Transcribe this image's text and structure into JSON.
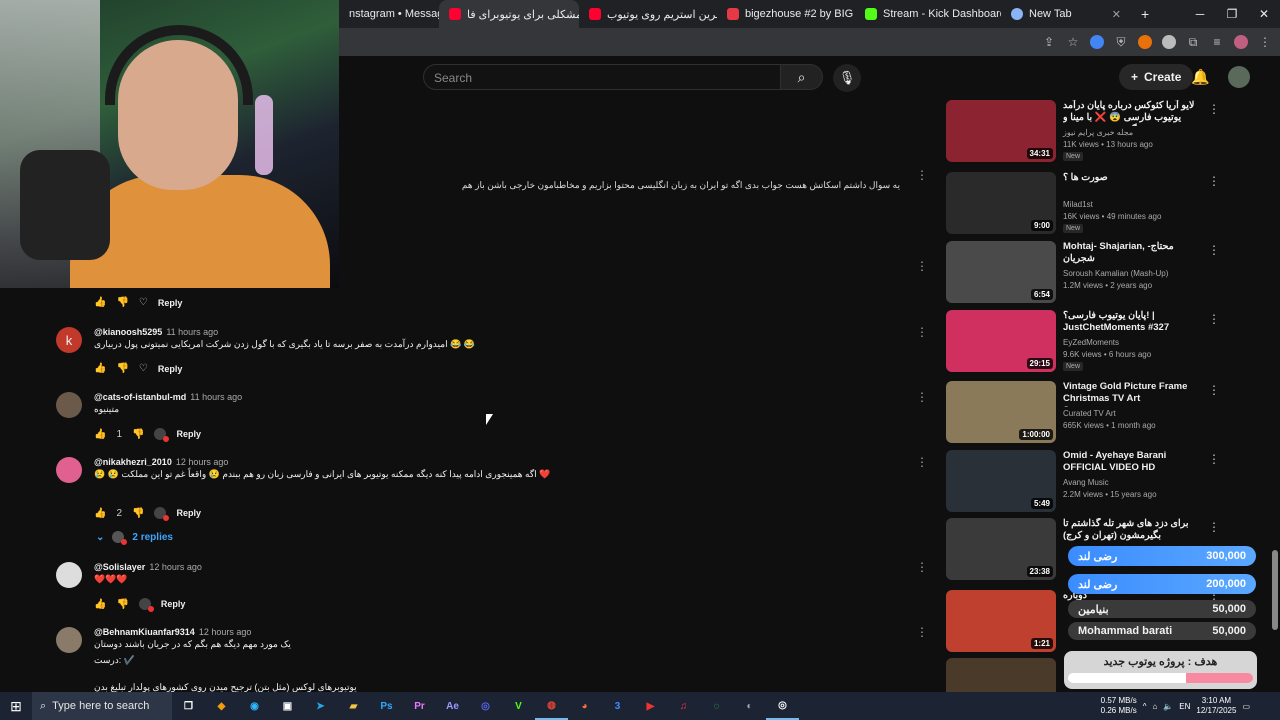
{
  "browser": {
    "tabs": [
      {
        "label": "nstagram • Messages",
        "color": "#888"
      },
      {
        "label": "چه مشکلی برای یوتیوبرای فا",
        "color": "#ff0033",
        "active": true
      },
      {
        "label": "آخرین استریم روی یوتیوب )",
        "color": "#ff0033"
      },
      {
        "label": "bigezhouse #2 by BIG",
        "color": "#e63946"
      },
      {
        "label": "Stream - Kick Dashboard",
        "color": "#53fc18"
      },
      {
        "label": "New Tab",
        "color": "#8ab4f8"
      }
    ]
  },
  "youtube": {
    "search_placeholder": "Search",
    "create_label": "Create"
  },
  "comments": {
    "top_text": "یه سوال داشتم اسکاتش هست جواب بدی اگه تو ایران به زبان انگلیسی محتوا بزاریم و مخاطبامون خارجی باشن باز هم",
    "reply_label": "Reply",
    "items": [
      {
        "user": "@kianoosh5295",
        "time": "11 hours ago",
        "text": "امیدوارم درآمدت به صفر برسه تا یاد بگیری که با گول زدن شرکت امریکایی نمیتونی پول دربیاری 😂 😂",
        "likes": "",
        "avatar_color": "#c0392b",
        "avatar_letter": "k"
      },
      {
        "user": "@cats-of-istanbul-md",
        "time": "11 hours ago",
        "text": "متینیوه",
        "likes": "1",
        "avatar_color": "#6b5a4a",
        "avatar_letter": ""
      },
      {
        "user": "@nikakhezri_2010",
        "time": "12 hours ago",
        "text": "😢 😢 اگه همینجوری ادامه پیدا کنه دیگه ممکنه یوتیوبر های ایرانی و فارسی زبان رو هم ببندم 😢 واقعاً غم تو این مملکت ❤️",
        "likes": "2",
        "avatar_color": "#e06090",
        "avatar_letter": ""
      },
      {
        "user": "@Solislayer",
        "time": "12 hours ago",
        "text": "❤️❤️❤️",
        "likes": "",
        "avatar_color": "#dddddd",
        "avatar_letter": ""
      },
      {
        "user": "@BehnamKiuanfar9314",
        "time": "12 hours ago",
        "text": "یک مورد مهم دیگه هم بگم که در جریان باشند دوستان",
        "likes": "",
        "avatar_color": "#8a7a6a",
        "avatar_letter": ""
      }
    ],
    "replies_label": "2 replies",
    "extra_line_1": "درست: ✔️",
    "extra_line_2": "یوتیوبرهای لوکس (مثل بتن) ترجیح میدن روی کشورهای پولدار تبلیغ بدن"
  },
  "sidebar_videos": [
    {
      "title": "لایو آریا کئوکس درباره پایان درآمد یوتیوب فارسی 😨 ❌ با مینا و گزروش هم صحبت",
      "channel": "مجله خبری پرایم نیوز",
      "meta": "11K views • 13 hours ago",
      "duration": "34:31",
      "new": "New",
      "thumb": "#8b2330"
    },
    {
      "title": "صورت ها ؟",
      "channel": "Milad1st",
      "meta": "16K views • 49 minutes ago",
      "duration": "9:00",
      "new": "New",
      "thumb": "#2a2a2a"
    },
    {
      "title": "Mohtaj- Shajarian, محتاج- شجریان",
      "channel": "Soroush Kamalian (Mash-Up)",
      "meta": "1.2M views • 2 years ago",
      "duration": "6:54",
      "new": "",
      "thumb": "#4a4a4a"
    },
    {
      "title": "پایان یوتیوب فارسی؟! | JustChetMoments #327",
      "channel": "EyZedMoments",
      "meta": "9.6K views • 6 hours ago",
      "duration": "29:15",
      "new": "New",
      "thumb": "#d03060"
    },
    {
      "title": "Vintage Gold Picture Frame Christmas TV Art Screensaver...",
      "channel": "Curated TV Art",
      "meta": "665K views • 1 month ago",
      "duration": "1:00:00",
      "new": "",
      "thumb": "#8a7a5a"
    },
    {
      "title": "Omid - Ayehaye Barani OFFICIAL VIDEO HD",
      "channel": "Avang Music",
      "meta": "2.2M views • 15 years ago",
      "duration": "5:49",
      "new": "",
      "thumb": "#2a3038"
    },
    {
      "title": "برای دزد های شهر تله گذاشتم تا بگیرمشون (تهران و کرج)",
      "channel": "",
      "meta": "",
      "duration": "23:38",
      "new": "",
      "thumb": "#3a3a3a"
    },
    {
      "title": "دوباره",
      "channel": "",
      "meta": "",
      "duration": "1:21",
      "new": "",
      "thumb": "#c04030"
    },
    {
      "title": "",
      "channel": "",
      "meta": "",
      "duration": "",
      "new": "",
      "thumb": "#4a3a2a"
    }
  ],
  "donations": [
    {
      "name": "رضی لند",
      "amount": "300,000"
    },
    {
      "name": "رضی لند",
      "amount": "200,000"
    },
    {
      "name": "بنیامین",
      "amount": "50,000"
    },
    {
      "name": "Mohammad barati",
      "amount": "50,000"
    }
  ],
  "goal": {
    "label": "هدف : پروژه یوتوب جدید",
    "progress": 0.36
  },
  "taskbar": {
    "search_placeholder": "Type here to search",
    "time": "3:10 AM",
    "date": "12/17/2025",
    "net_up": "0.57 MB/s",
    "net_down": "0.26 MB/s",
    "apps": [
      "Ai",
      "Ps",
      "Pr",
      "Ae",
      "V"
    ]
  }
}
